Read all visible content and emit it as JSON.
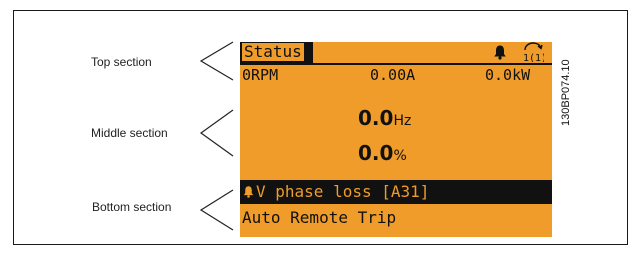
{
  "labels": {
    "top": "Top section",
    "middle": "Middle section",
    "bottom": "Bottom section"
  },
  "display": {
    "status_title": "Status",
    "readouts": {
      "rpm": "0RPM",
      "current": "0.00A",
      "power": "0.0kW"
    },
    "main_value_1": "0.0",
    "main_unit_1": "Hz",
    "main_value_2": "0.0",
    "main_unit_2": "%",
    "alarm_text": "V phase loss [A31]",
    "trip_text": "Auto Remote Trip",
    "hand_icon_text": "1(1)"
  },
  "figure_code": "130BP074.10",
  "colors": {
    "lcd_background": "#ef9c2a",
    "lcd_foreground": "#111111"
  },
  "icons": {
    "status_bell": "bell-icon",
    "hand": "hand-icon",
    "alarm_bell": "alarm-bell-icon"
  }
}
